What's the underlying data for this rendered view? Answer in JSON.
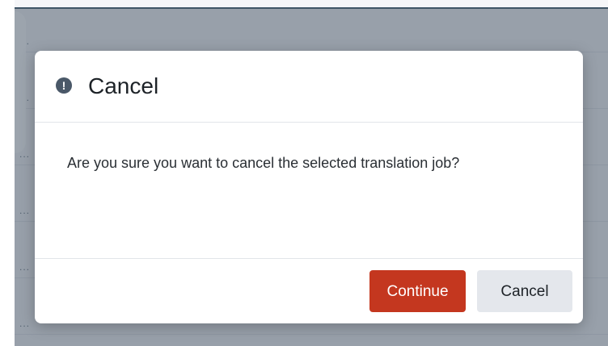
{
  "background": {
    "row_ellipsis": "..."
  },
  "dialog": {
    "title": "Cancel",
    "icon": "exclamation-circle-icon",
    "icon_glyph": "!",
    "message": "Are you sure you want to cancel the selected translation job?",
    "continue_label": "Continue",
    "cancel_label": "Cancel"
  },
  "colors": {
    "continue_button": "#c4371f",
    "cancel_button": "#e4e7ec",
    "overlay": "#4a5a6a"
  }
}
